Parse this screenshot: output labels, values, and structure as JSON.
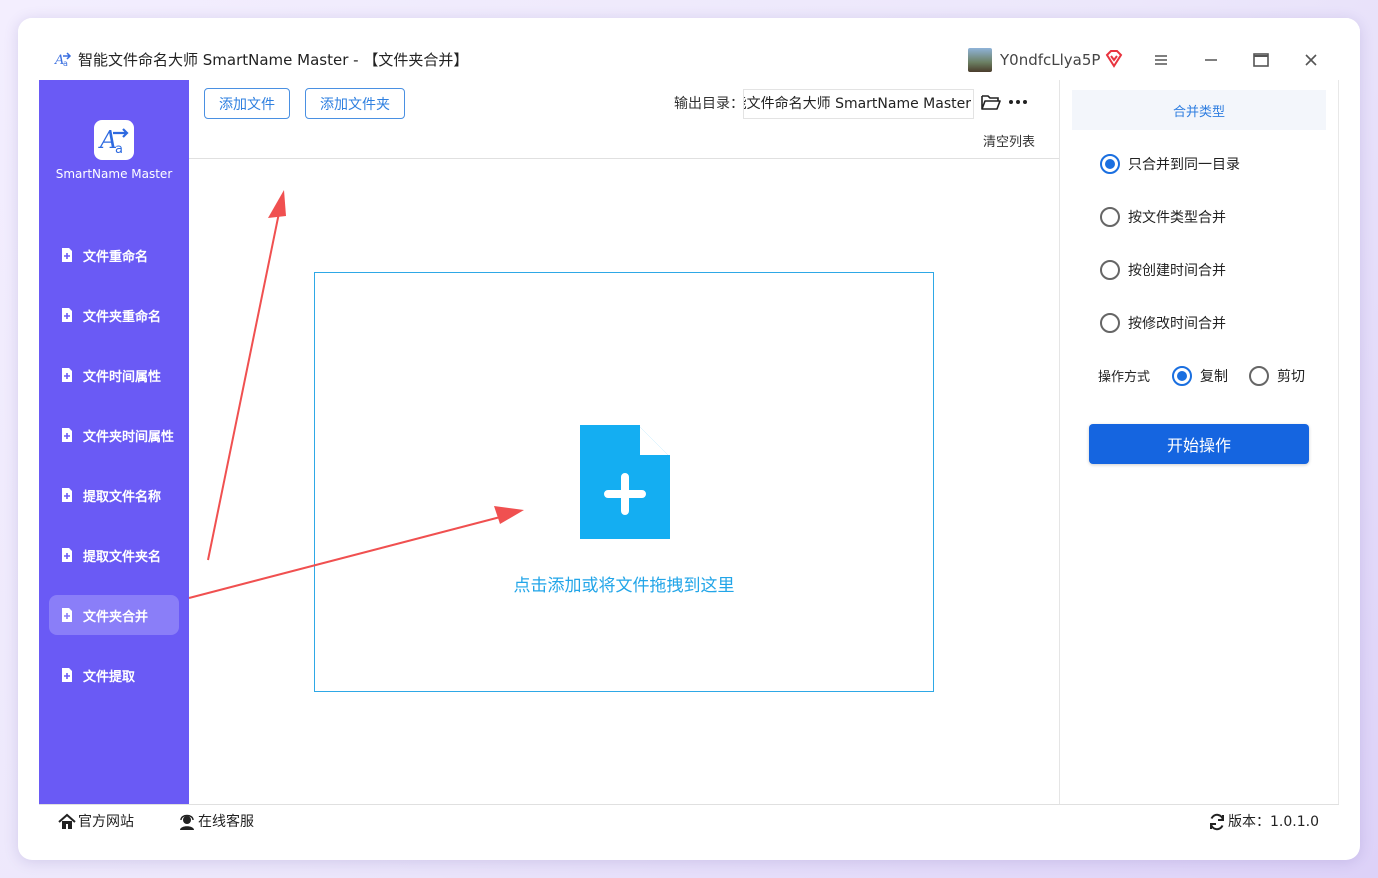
{
  "window": {
    "title": "智能文件命名大师 SmartName Master - 【文件夹合并】",
    "user_name": "Y0ndfcLlya5P"
  },
  "sidebar": {
    "logo_text": "SmartName Master",
    "items": [
      {
        "label": "文件重命名"
      },
      {
        "label": "文件夹重命名"
      },
      {
        "label": "文件时间属性"
      },
      {
        "label": "文件夹时间属性"
      },
      {
        "label": "提取文件名称"
      },
      {
        "label": "提取文件夹名"
      },
      {
        "label": "文件夹合并"
      },
      {
        "label": "文件提取"
      }
    ],
    "active_index": 6
  },
  "toolbar": {
    "add_file": "添加文件",
    "add_folder": "添加文件夹",
    "output_label": "输出目录：",
    "output_value": "智能文件命名大师 SmartName Master",
    "clear_list": "清空列表"
  },
  "dropzone": {
    "text": "点击添加或将文件拖拽到这里"
  },
  "panel": {
    "header": "合并类型",
    "options": [
      {
        "label": "只合并到同一目录",
        "checked": true
      },
      {
        "label": "按文件类型合并",
        "checked": false
      },
      {
        "label": "按创建时间合并",
        "checked": false
      },
      {
        "label": "按修改时间合并",
        "checked": false
      }
    ],
    "operation_label": "操作方式",
    "op_copy": "复制",
    "op_cut": "剪切",
    "op_selected": "复制",
    "start_button": "开始操作"
  },
  "footer": {
    "website": "官方网站",
    "service": "在线客服",
    "version": "版本：1.0.1.0"
  },
  "colors": {
    "sidebar_bg": "#6a5af5",
    "sidebar_active": "#8a7ef8",
    "accent_blue": "#1565e0",
    "drop_blue": "#22a5e8",
    "arrow_red": "#f05050"
  }
}
